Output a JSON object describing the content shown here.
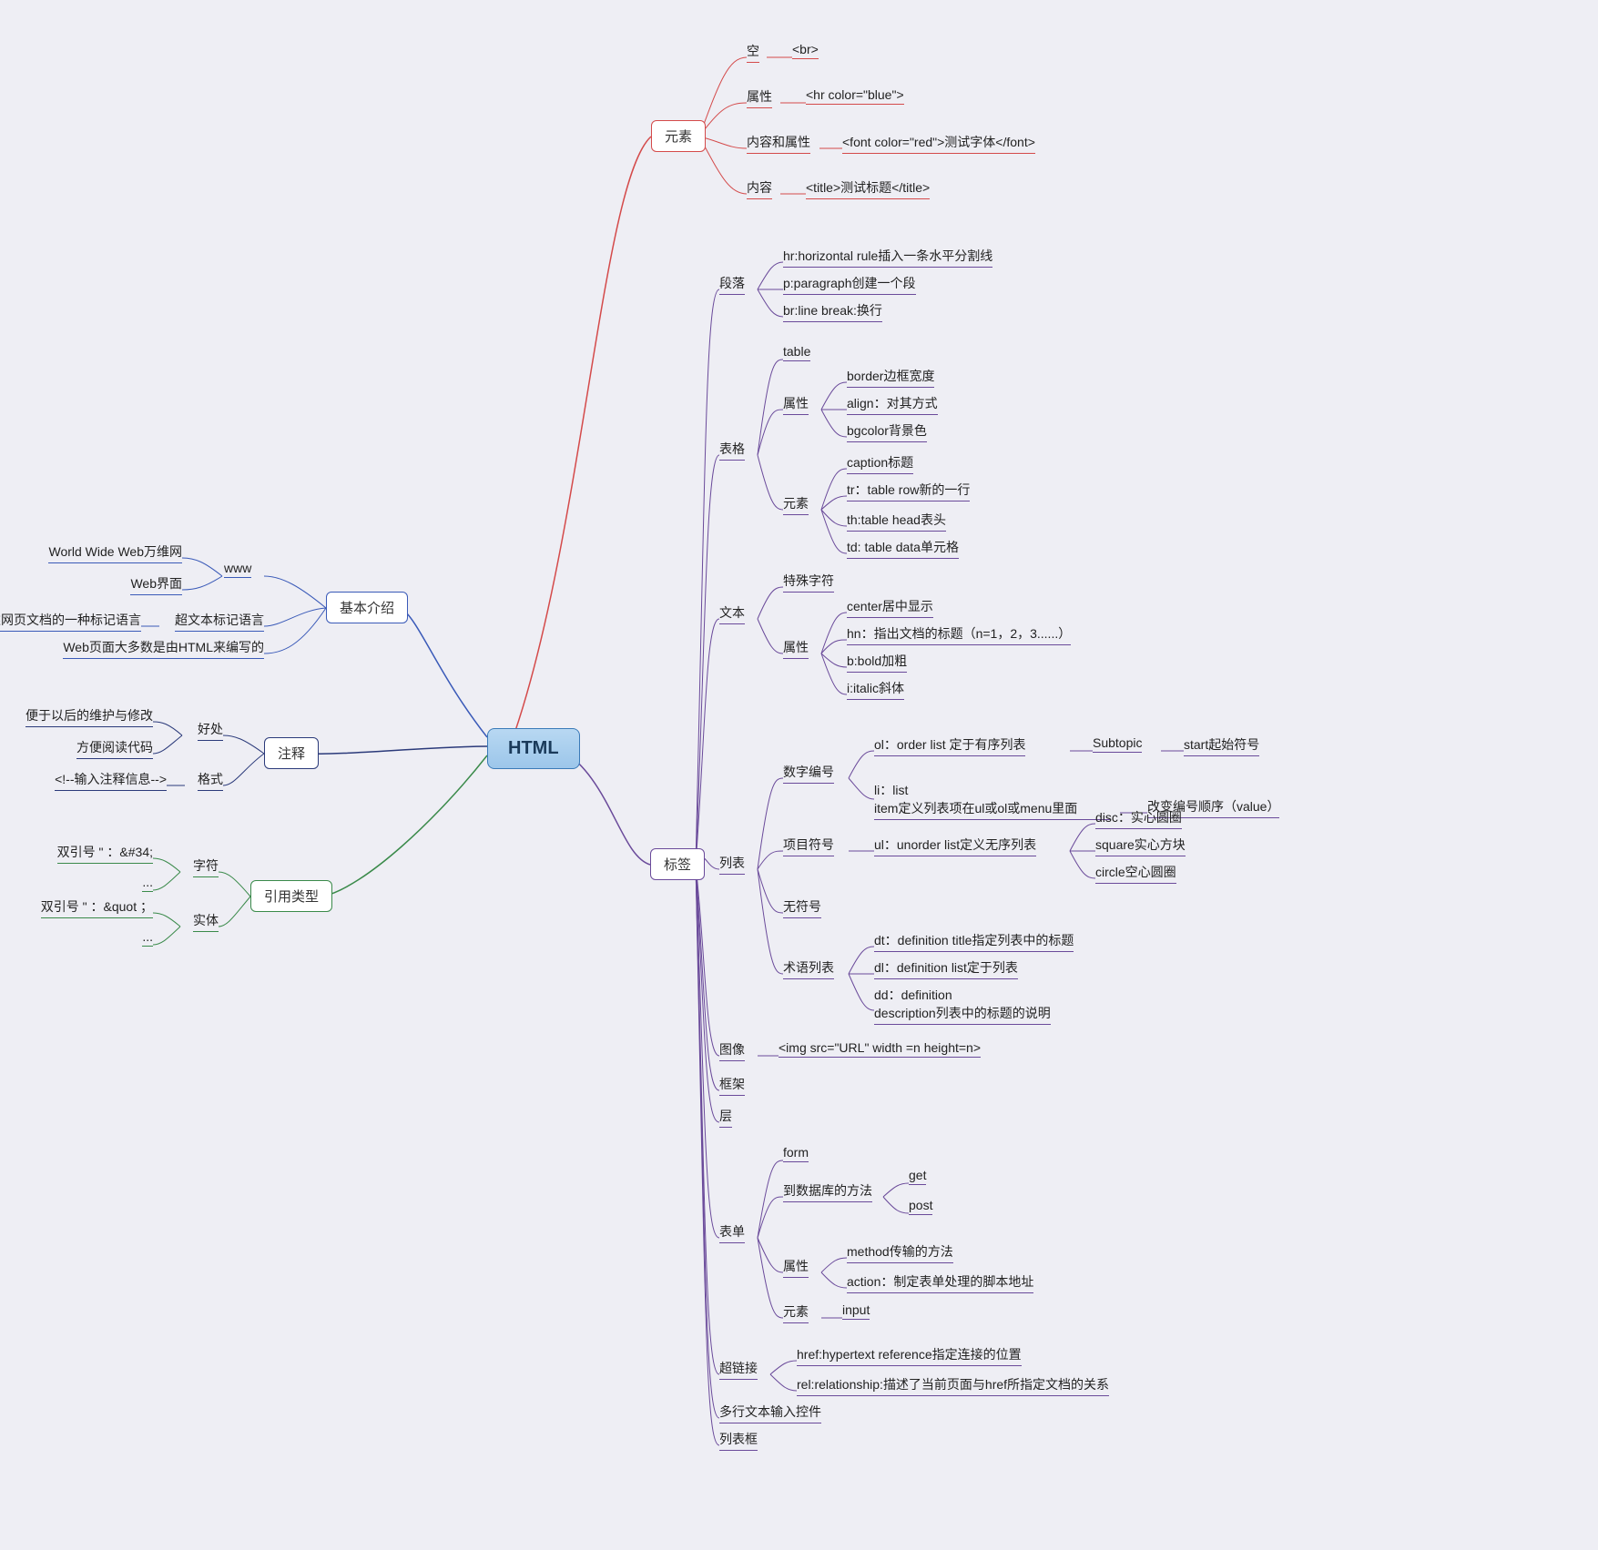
{
  "root": "HTML",
  "left": {
    "intro": {
      "label": "基本介绍",
      "www": {
        "label": "www",
        "children": [
          "World Wide Web万维网",
          "Web界面"
        ]
      },
      "hypertext": {
        "label": "超文本标记语言",
        "child": "用于描述网页文档的一种标记语言"
      },
      "most": "Web页面大多数是由HTML来编写的"
    },
    "comment": {
      "label": "注释",
      "benefit": {
        "label": "好处",
        "children": [
          "便于以后的维护与修改",
          "方便阅读代码"
        ]
      },
      "format": {
        "label": "格式",
        "child": "<!--输入注释信息-->"
      }
    },
    "refs": {
      "label": "引用类型",
      "char": {
        "label": "字符",
        "children": [
          "双引号 \" ：&#34;",
          "..."
        ]
      },
      "entity": {
        "label": "实体",
        "children": [
          "双引号 \" ：&quot ；",
          "..."
        ]
      }
    }
  },
  "elem": {
    "label": "元素",
    "empty": {
      "label": "空",
      "val": "<br>"
    },
    "attr": {
      "label": "属性",
      "val": "<hr color=\"blue\">"
    },
    "both": {
      "label": "内容和属性",
      "val": "<font color=\"red\">测试字体</font>"
    },
    "content": {
      "label": "内容",
      "val": "<title>测试标题</title>"
    }
  },
  "tag": {
    "label": "标签",
    "para": {
      "label": "段落",
      "children": [
        "hr:horizontal rule插入一条水平分割线",
        "p:paragraph创建一个段",
        "br:line break:换行"
      ]
    },
    "table": {
      "label": "表格",
      "table": "table",
      "attr": {
        "label": "属性",
        "children": [
          "border边框宽度",
          "align：对其方式",
          "bgcolor背景色"
        ]
      },
      "elem": {
        "label": "元素",
        "children": [
          "caption标题",
          "tr：table row新的一行",
          "th:table head表头",
          "td: table data单元格"
        ]
      }
    },
    "text": {
      "label": "文本",
      "special": "特殊字符",
      "attr": {
        "label": "属性",
        "children": [
          "center居中显示",
          "hn：指出文档的标题（n=1，2，3......）",
          "b:bold加粗",
          "i:italic斜体"
        ]
      }
    },
    "list": {
      "label": "列表",
      "num": {
        "label": "数字编号",
        "ol": {
          "text": "ol：order list 定于有序列表",
          "sub": "Subtopic",
          "start": "start起始符号"
        },
        "li": {
          "text": "li：list\nitem定义列表项在ul或ol或menu里面",
          "val": "改变编号顺序（value）"
        }
      },
      "bullet": {
        "label": "项目符号",
        "ul": "ul：unorder list定义无序列表",
        "children": [
          "disc：实心圆圈",
          "square实心方块",
          "circle空心圆圈"
        ]
      },
      "none": "无符号",
      "term": {
        "label": "术语列表",
        "children": [
          "dt：definition title指定列表中的标题",
          "dl：definition list定于列表",
          "dd：definition\ndescription列表中的标题的说明"
        ]
      }
    },
    "image": {
      "label": "图像",
      "val": "<img src=\"URL\" width =n height=n>"
    },
    "frame": "框架",
    "layer": "层",
    "form": {
      "label": "表单",
      "form": "form",
      "db": {
        "label": "到数据库的方法",
        "children": [
          "get",
          "post"
        ]
      },
      "attr": {
        "label": "属性",
        "children": [
          "method传输的方法",
          "action：制定表单处理的脚本地址"
        ]
      },
      "elem": {
        "label": "元素",
        "val": "input"
      }
    },
    "link": {
      "label": "超链接",
      "children": [
        "href:hypertext reference指定连接的位置",
        "rel:relationship:描述了当前页面与href所指定文档的关系"
      ]
    },
    "textarea": "多行文本输入控件",
    "listbox": "列表框"
  }
}
